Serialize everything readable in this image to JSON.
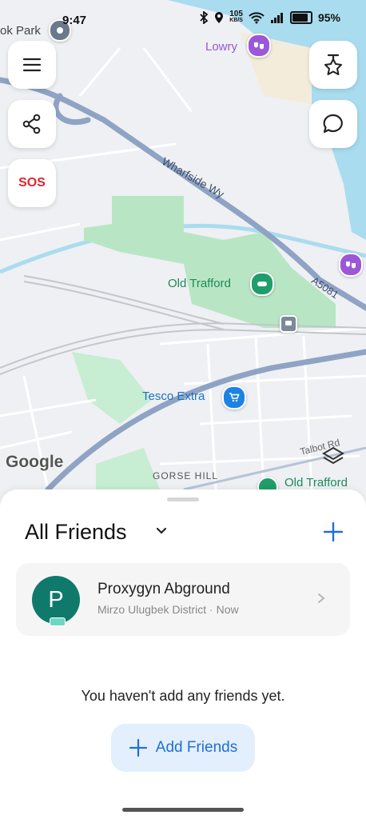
{
  "status_bar": {
    "time": "9:47",
    "network_speed": "105",
    "network_unit": "KB/S",
    "battery": "95%"
  },
  "map": {
    "labels": {
      "park": "ok Park",
      "lowry": "Lowry",
      "wharfside": "Wharfside Wy",
      "old_trafford": "Old Trafford",
      "road_a5081": "A5081",
      "tesco": "Tesco Extra",
      "gorse_hill": "GORSE HILL",
      "talbot": "Talbot Rd",
      "old_trafford_station": "Old Trafford"
    },
    "google_logo": "Google",
    "colors": {
      "water": "#a9dcef",
      "park": "#b8e6c4",
      "road_major": "#8fa3c4",
      "park_pin": "#1f9d6a",
      "attraction_pin": "#9b57d6",
      "shop_pin": "#1c82e6"
    }
  },
  "buttons": {
    "sos_label": "SOS"
  },
  "sheet": {
    "title": "All Friends",
    "friend": {
      "initial": "P",
      "name": "Proxygyn Abground",
      "location": "Mirzo Ulugbek District",
      "separator": "·",
      "time": "Now"
    },
    "empty_message": "You haven't add any friends yet.",
    "add_friends_label": "Add Friends"
  }
}
